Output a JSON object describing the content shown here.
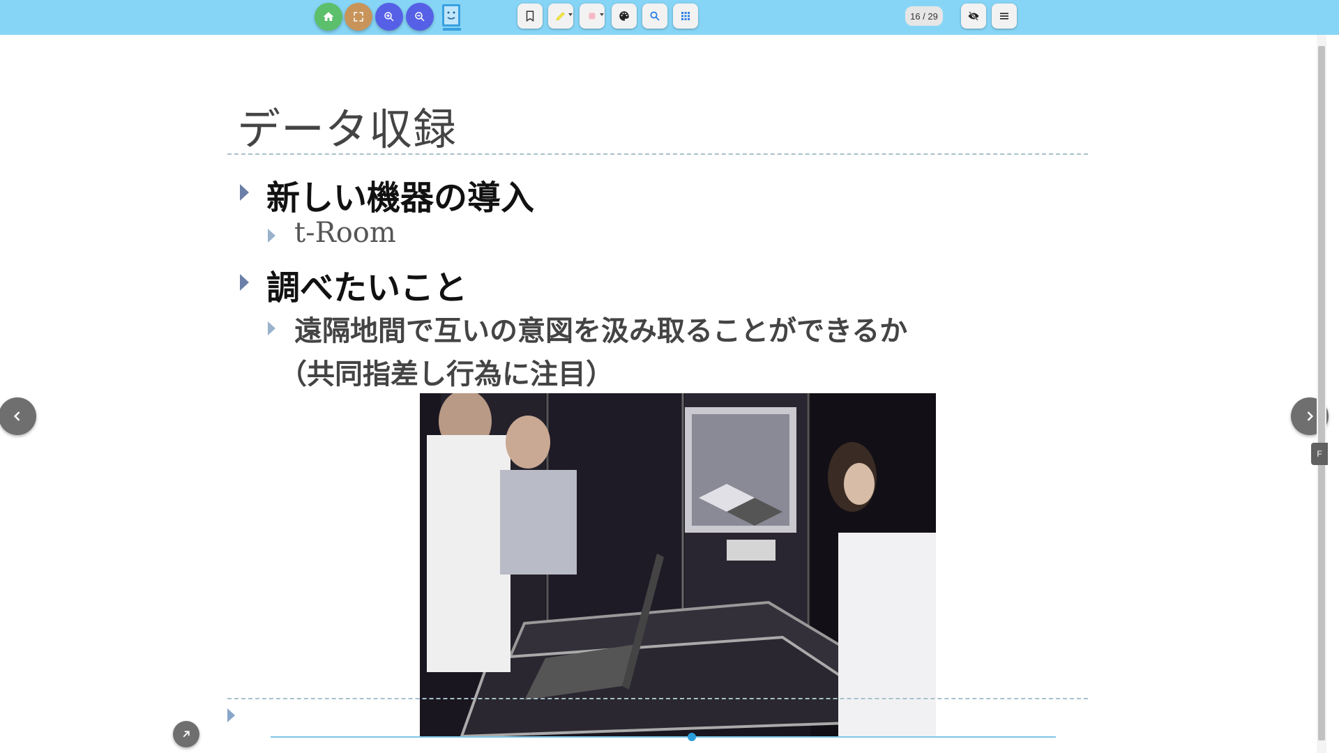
{
  "toolbar": {
    "buttons": [
      {
        "name": "home-icon",
        "color": "#5cbf6b"
      },
      {
        "name": "fullscreen-icon",
        "color": "#c8945a"
      },
      {
        "name": "zoom-in-icon",
        "color": "#5560e6"
      },
      {
        "name": "zoom-out-icon",
        "color": "#5560e6"
      }
    ],
    "tools": [
      "bookmark-icon",
      "highlighter-icon",
      "eraser-icon",
      "palette-icon",
      "search-icon",
      "grid-icon"
    ],
    "page_counter": "16 / 29",
    "right": [
      "hide-icon",
      "menu-icon"
    ]
  },
  "slide": {
    "title": "データ収録",
    "items": [
      {
        "level": 1,
        "text": "新しい機器の導入"
      },
      {
        "level": 2,
        "text": "t-Room"
      },
      {
        "level": 1,
        "text": "調べたいこと"
      },
      {
        "level": 2,
        "text": "遠隔地間で互いの意図を汲み取ることができるか"
      },
      {
        "level": 2,
        "text": "（共同指差し行為に注目）"
      }
    ],
    "image": "photo of people in t-Room"
  },
  "side_tab": "F",
  "progress_fraction": 0.53,
  "colors": {
    "toolbar_bg": "#87d5f6",
    "nav": "#6f6f6f",
    "bullet": "#6b7fa8"
  }
}
